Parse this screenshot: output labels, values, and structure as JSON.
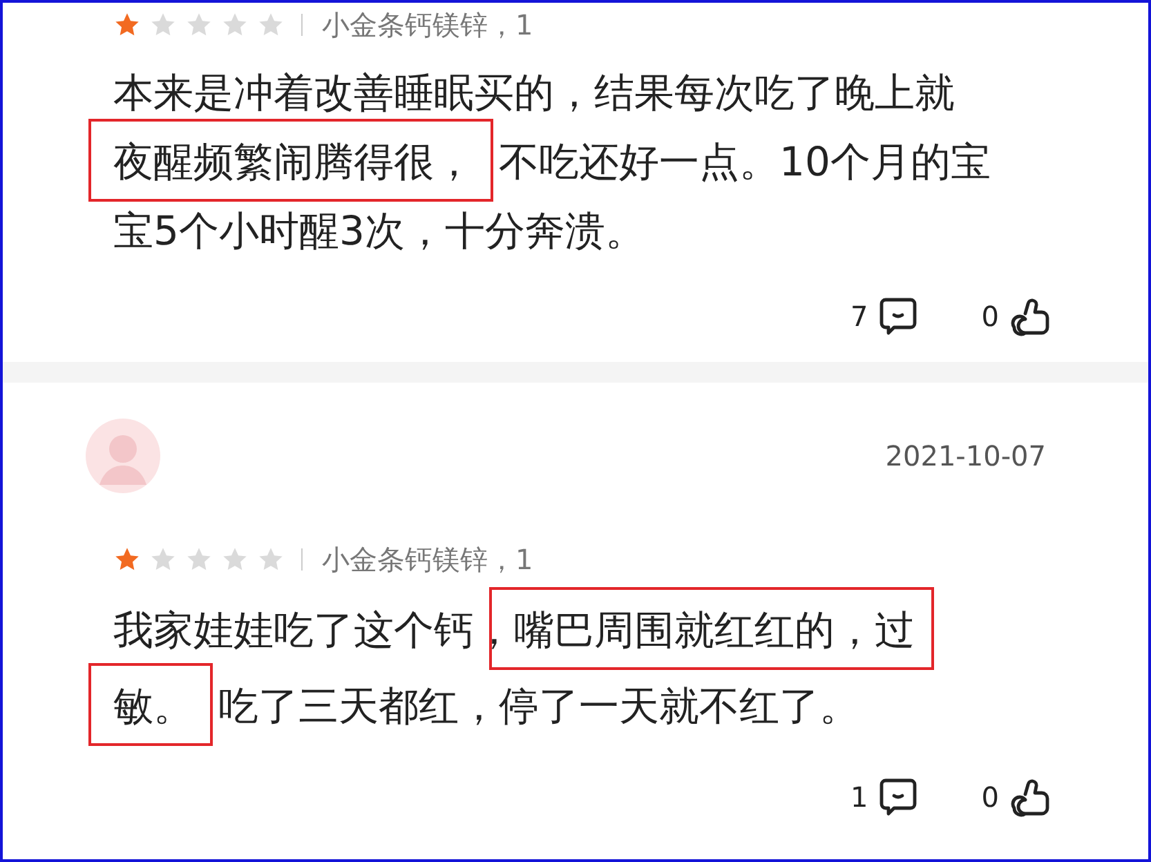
{
  "reviews": [
    {
      "stars": 1,
      "product": "小金条钙镁锌，1",
      "lines": [
        [
          {
            "text": "本来是冲着改善睡眠买的，结果每次吃了晚上就",
            "highlighted": false
          }
        ],
        [
          {
            "text": "夜醒频繁闹腾得很，",
            "highlighted": true
          },
          {
            "text": "不吃还好一点。10个月的宝",
            "highlighted": false
          }
        ],
        [
          {
            "text": "宝5个小时醒3次，十分奔溃。",
            "highlighted": false
          }
        ]
      ],
      "comment_count": "7",
      "like_count": "0"
    },
    {
      "date": "2021-10-07",
      "stars": 1,
      "product": "小金条钙镁锌，1",
      "lines": [
        [
          {
            "text": "我家娃娃吃了这个钙，",
            "highlighted": false
          },
          {
            "text": "嘴巴周围就红红的，过",
            "highlighted": true
          }
        ],
        [
          {
            "text": "敏。",
            "highlighted": true
          },
          {
            "text": "吃了三天都红，停了一天就不红了。",
            "highlighted": false
          }
        ]
      ],
      "comment_count": "1",
      "like_count": "0"
    }
  ]
}
